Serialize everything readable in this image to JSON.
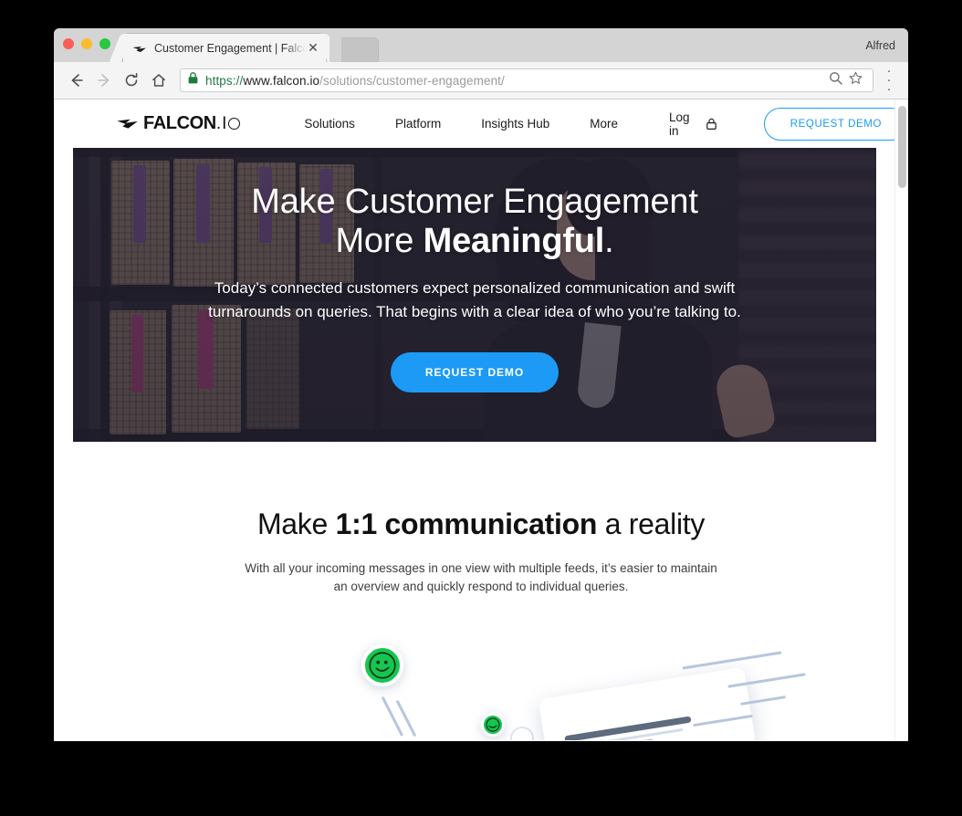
{
  "browser": {
    "profile_name": "Alfred",
    "tab": {
      "title": "Customer Engagement | Falcon",
      "favicon": "falcon-bird-icon",
      "close_label": "✕"
    },
    "new_tab_label": "",
    "toolbar": {
      "back_icon": "←",
      "forward_icon": "→",
      "reload_icon": "↻",
      "home_icon": "⌂",
      "lock_icon": "padlock-icon",
      "zoom_icon": "⌕",
      "bookmark_icon": "☆",
      "menu_icon": "three-dot-menu-icon",
      "url": {
        "scheme": "https://",
        "host": "www.falcon.io",
        "path": "/solutions/customer-engagement/"
      }
    }
  },
  "site": {
    "logo": {
      "word": "FALCON",
      "dot": ".",
      "io": "I",
      "ring": "O"
    },
    "nav": [
      {
        "label": "Solutions"
      },
      {
        "label": "Platform"
      },
      {
        "label": "Insights Hub"
      },
      {
        "label": "More"
      }
    ],
    "login": {
      "label": "Log in",
      "icon": "lock-icon"
    },
    "header_cta": {
      "label": "REQUEST DEMO",
      "color": "#1c9af5"
    }
  },
  "hero": {
    "heading_line1": "Make Customer Engagement",
    "heading_line2_prefix": "More ",
    "heading_line2_bold": "Meaningful",
    "heading_line2_suffix": ".",
    "subtitle": "Today’s connected customers expect personalized communication and swift turnarounds on queries. That begins with a clear idea of who you’re talking to.",
    "cta": {
      "label": "REQUEST DEMO",
      "color": "#1c9af5"
    },
    "image_alt": "woman-shopping-with-phone-photo"
  },
  "section": {
    "heading_prefix": "Make ",
    "heading_bold": "1:1 communication",
    "heading_suffix": " a reality",
    "paragraph": "With all your incoming messages in one view with multiple feeds, it’s easier to maintain an overview and quickly respond to individual queries.",
    "illustration_alt": "green-smiley-bubbles-and-message-card-illustration"
  },
  "colors": {
    "accent_blue": "#1c9af5",
    "smiley_green": "#16c64f",
    "streak_blue": "#b6c6dc"
  },
  "scrollbar": {
    "position": "top"
  }
}
